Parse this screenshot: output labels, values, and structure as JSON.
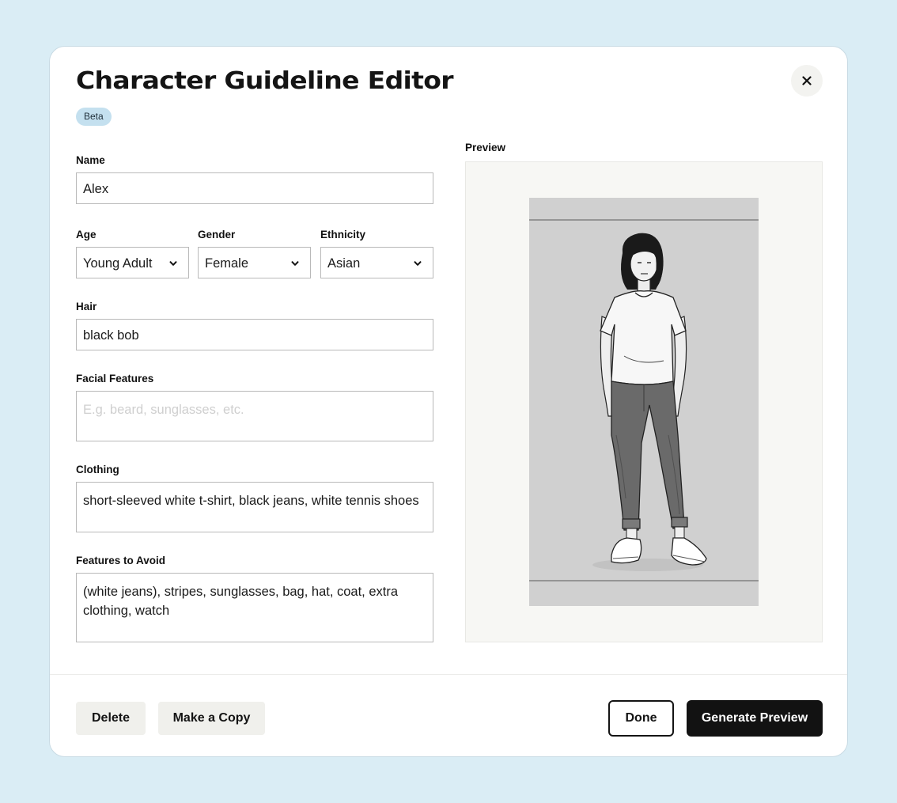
{
  "dialog": {
    "title": "Character Guideline Editor",
    "badge": "Beta"
  },
  "form": {
    "name": {
      "label": "Name",
      "value": "Alex"
    },
    "age": {
      "label": "Age",
      "value": "Young Adult"
    },
    "gender": {
      "label": "Gender",
      "value": "Female"
    },
    "ethnicity": {
      "label": "Ethnicity",
      "value": "Asian"
    },
    "hair": {
      "label": "Hair",
      "value": "black bob"
    },
    "facial_features": {
      "label": "Facial Features",
      "value": "",
      "placeholder": "E.g. beard, sunglasses, etc."
    },
    "clothing": {
      "label": "Clothing",
      "value": "short-sleeved white t-shirt, black jeans, white tennis shoes"
    },
    "avoid": {
      "label": "Features to Avoid",
      "value": "(white jeans), stripes, sunglasses, bag, hat, coat, extra clothing, watch"
    }
  },
  "preview": {
    "label": "Preview"
  },
  "footer": {
    "delete_label": "Delete",
    "copy_label": "Make a Copy",
    "done_label": "Done",
    "generate_label": "Generate Preview"
  },
  "colors": {
    "page_background": "#daedf5",
    "badge": "#c4e0ef",
    "primary_button": "#121212",
    "ghost_button": "#f0f0ec",
    "preview_background": "#f7f7f4"
  },
  "icons": {
    "close": "close-icon",
    "select": "chevron-down-icon",
    "preview_image": "character-illustration"
  }
}
